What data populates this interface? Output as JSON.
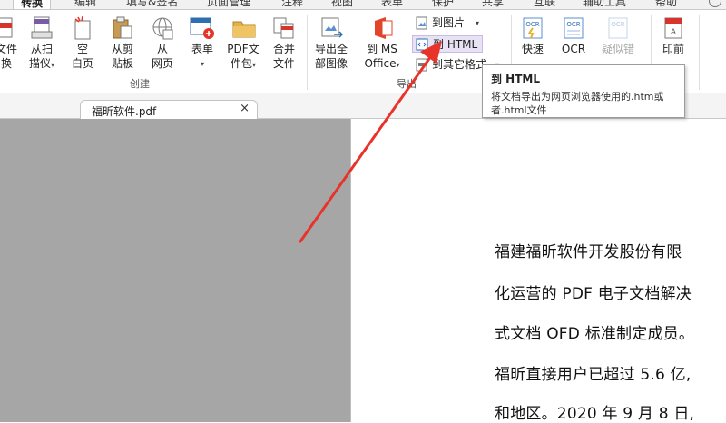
{
  "tabs": [
    {
      "label": "转换",
      "active": true
    },
    {
      "label": "编辑"
    },
    {
      "label": "填写&签名"
    },
    {
      "label": "页面管理"
    },
    {
      "label": "注释"
    },
    {
      "label": "视图"
    },
    {
      "label": "表单"
    },
    {
      "label": "保护"
    },
    {
      "label": "共享"
    },
    {
      "label": "互联"
    },
    {
      "label": "辅助工具"
    },
    {
      "label": "帮助"
    }
  ],
  "ribbon": {
    "create": {
      "group_label": "创建",
      "from_file": {
        "line1": "文件",
        "line2": "换"
      },
      "from_scanner": {
        "line1": "从扫",
        "line2": "描仪"
      },
      "blank": {
        "line1": "空",
        "line2": "白页"
      },
      "clipboard": {
        "line1": "从剪",
        "line2": "贴板"
      },
      "web": {
        "line1": "从",
        "line2": "网页"
      },
      "form": {
        "line1": "表单"
      },
      "portfolio": {
        "line1": "PDF文",
        "line2": "件包"
      },
      "merge": {
        "line1": "合并",
        "line2": "文件"
      }
    },
    "export": {
      "group_label": "导出",
      "all_images": {
        "line1": "导出全",
        "line2": "部图像"
      },
      "ms_office": {
        "line1": "到 MS",
        "line2": "Office"
      },
      "to_image": "到图片",
      "to_html": "到 HTML",
      "to_other": "到其它格式"
    },
    "ocr": {
      "quick": {
        "line1": "快速"
      },
      "ocr": {
        "line1": "OCR"
      },
      "suspect": {
        "line1": "疑似错"
      }
    },
    "preflight": {
      "line1": "印前"
    }
  },
  "document_tab": {
    "name": "福昕软件.pdf",
    "close": "×"
  },
  "document_lines": [
    "福建福昕软件开发股份有限",
    "化运营的 PDF 电子文档解决",
    "式文档 OFD 标准制定成员。",
    "福昕直接用户已超过 5.6 亿,",
    "和地区。2020 年 9 月 8 日,"
  ],
  "tooltip": {
    "title": "到 HTML",
    "body": "将文档导出为网页浏览器使用的.htm或者.html文件"
  },
  "colors": {
    "arrow": "#e8332b",
    "pdf_red": "#d9342b",
    "hover_fill": "#e8e3f4",
    "gray_pane": "#a6a6a6"
  }
}
